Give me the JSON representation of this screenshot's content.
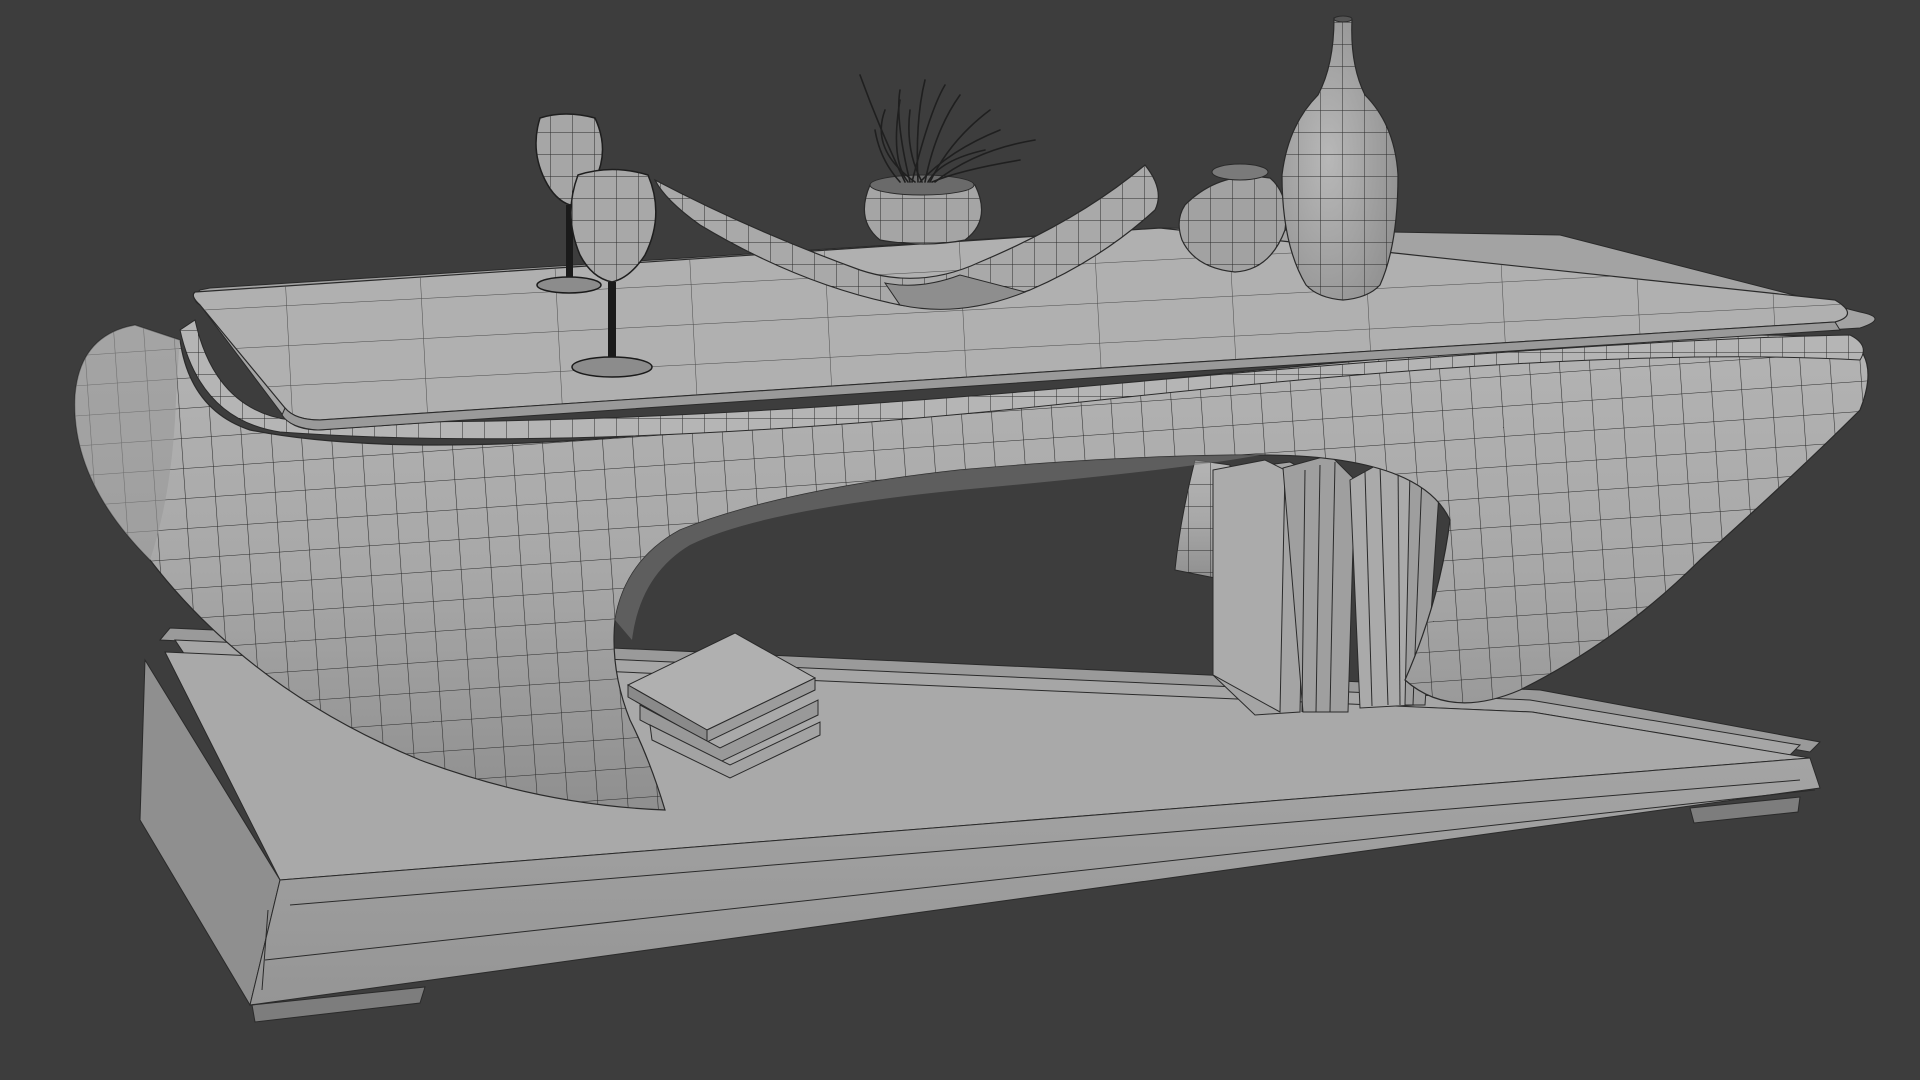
{
  "scene": {
    "background": "#3d3d3d",
    "shade": {
      "light": "#b3b3b3",
      "mid": "#a1a1a1",
      "dark": "#8a8a8a",
      "wire": "#2a2a2a"
    },
    "objects": [
      "base-plinth",
      "table-body",
      "table-top",
      "wine-glass",
      "wine-glass",
      "curved-tray",
      "planter-pot",
      "grass",
      "round-bowl",
      "tall-vase",
      "standing-books",
      "stacked-books"
    ]
  }
}
